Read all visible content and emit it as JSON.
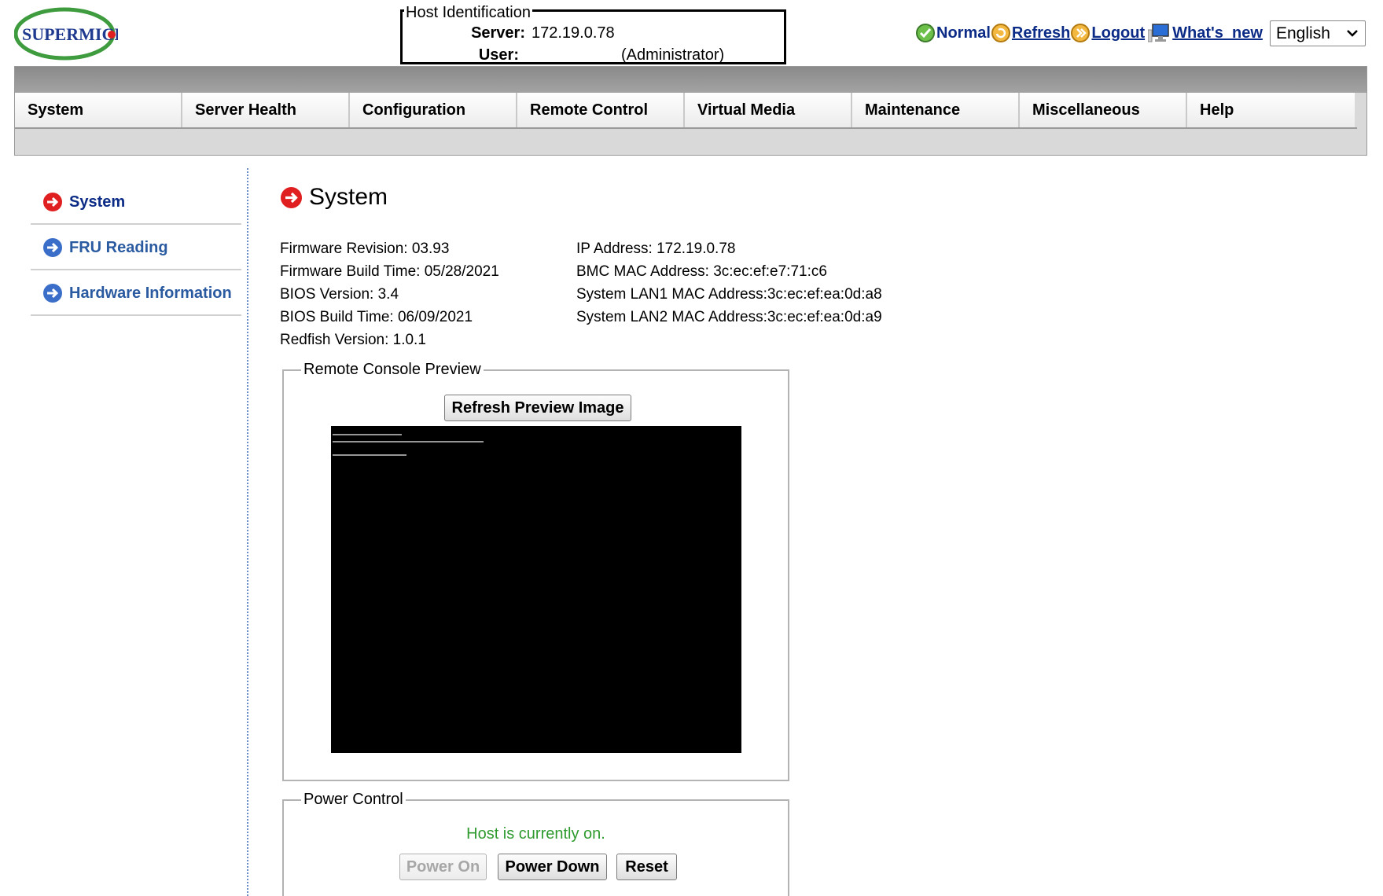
{
  "header": {
    "logo_text": "SUPERMICRO",
    "host_identification": {
      "legend": "Host Identification",
      "server_label": "Server:",
      "server_value": "172.19.0.78",
      "user_label": "User:",
      "user_value": "(Administrator)"
    },
    "links": {
      "normal": "Normal",
      "refresh": "Refresh",
      "logout": "Logout",
      "whats_new": "What's  new"
    },
    "language": "English"
  },
  "nav": [
    "System",
    "Server Health",
    "Configuration",
    "Remote Control",
    "Virtual Media",
    "Maintenance",
    "Miscellaneous",
    "Help"
  ],
  "sidebar": {
    "items": [
      {
        "label": "System"
      },
      {
        "label": "FRU Reading"
      },
      {
        "label": "Hardware Information"
      }
    ]
  },
  "main": {
    "title": "System",
    "info_left": [
      "Firmware Revision: 03.93",
      "Firmware Build Time: 05/28/2021",
      "BIOS Version: 3.4",
      "BIOS Build Time: 06/09/2021",
      "Redfish Version: 1.0.1"
    ],
    "info_right": [
      "IP Address: 172.19.0.78",
      "BMC MAC Address: 3c:ec:ef:e7:71:c6",
      "System LAN1 MAC Address:3c:ec:ef:ea:0d:a8",
      "System LAN2 MAC Address:3c:ec:ef:ea:0d:a9"
    ],
    "console": {
      "legend": "Remote Console Preview",
      "refresh_button": "Refresh Preview Image"
    },
    "power": {
      "legend": "Power Control",
      "status": "Host is currently on.",
      "power_on": "Power On",
      "power_down": "Power Down",
      "reset": "Reset"
    }
  },
  "colors": {
    "link_blue": "#0b2b86",
    "sidebar_blue": "#2a5aa0",
    "status_green": "#2e9a2e",
    "arrow_red": "#e02020",
    "arrow_blue": "#3a6ec8"
  }
}
